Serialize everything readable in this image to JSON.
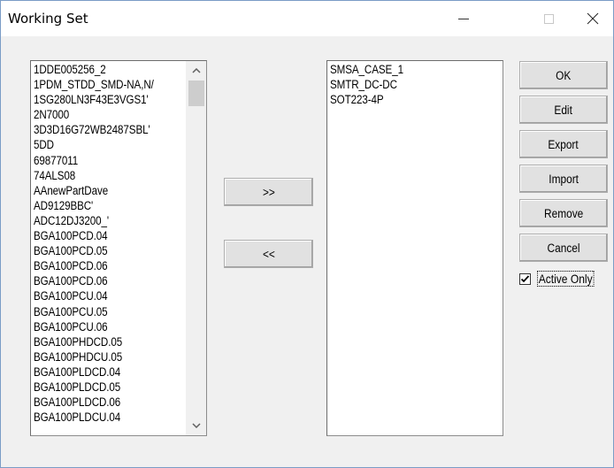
{
  "window": {
    "title": "Working Set"
  },
  "available_list": {
    "items": [
      "1DDE005256_2",
      "1PDM_STDD_SMD-NA,N/",
      "1SG280LN3F43E3VGS1'",
      "2N7000",
      "3D3D16G72WB2487SBL'",
      "5DD",
      "69877011",
      "74ALS08",
      "AAnewPartDave",
      "AD9129BBC'",
      "ADC12DJ3200_'",
      "BGA100PCD.04",
      "BGA100PCD.05",
      "BGA100PCD.06",
      "BGA100PCD.06",
      "BGA100PCU.04",
      "BGA100PCU.05",
      "BGA100PCU.06",
      "BGA100PHDCD.05",
      "BGA100PHDCU.05",
      "BGA100PLDCD.04",
      "BGA100PLDCD.05",
      "BGA100PLDCD.06",
      "BGA100PLDCU.04"
    ]
  },
  "selected_list": {
    "items": [
      "SMSA_CASE_1",
      "SMTR_DC-DC",
      "SOT223-4P"
    ]
  },
  "move_buttons": {
    "add_label": ">>",
    "remove_label": "<<"
  },
  "side_buttons": {
    "ok_label": "OK",
    "edit_label": "Edit",
    "export_label": "Export",
    "import_label": "Import",
    "remove_label": "Remove",
    "cancel_label": "Cancel"
  },
  "active_only": {
    "label": "Active Only",
    "checked": true
  },
  "icons": {
    "minimize": "minimize-icon",
    "maximize": "maximize-icon",
    "close": "close-icon",
    "scroll_up": "chevron-up-icon",
    "scroll_down": "chevron-down-icon",
    "check": "checkmark-icon"
  }
}
